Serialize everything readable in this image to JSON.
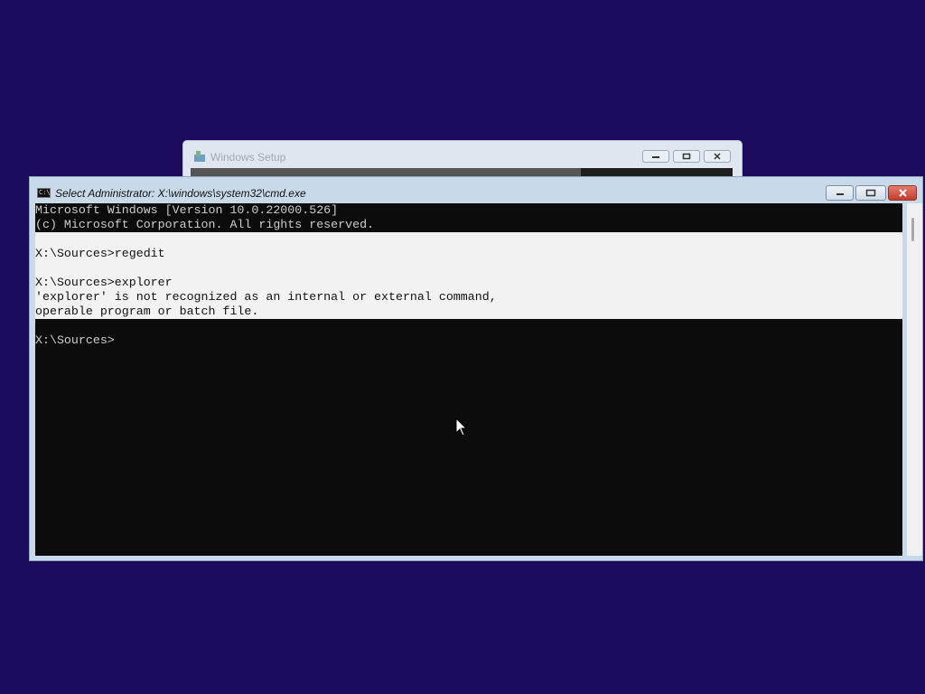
{
  "background_window": {
    "title": "Windows Setup",
    "progress": 0.72
  },
  "cmd": {
    "title": "Select Administrator: X:\\windows\\system32\\cmd.exe",
    "icon_text": "C:\\",
    "lines": [
      "Microsoft Windows [Version 10.0.22000.526]",
      "(c) Microsoft Corporation. All rights reserved.",
      "",
      "X:\\Sources>regedit",
      "",
      "X:\\Sources>explorer",
      "'explorer' is not recognized as an internal or external command,",
      "operable program or batch file.",
      "",
      "X:\\Sources>"
    ]
  },
  "colors": {
    "desktop": "#1c0a5c",
    "console_bg": "#0c0c0c",
    "console_text": "#cccccc",
    "selection": "#f2f2f2"
  }
}
